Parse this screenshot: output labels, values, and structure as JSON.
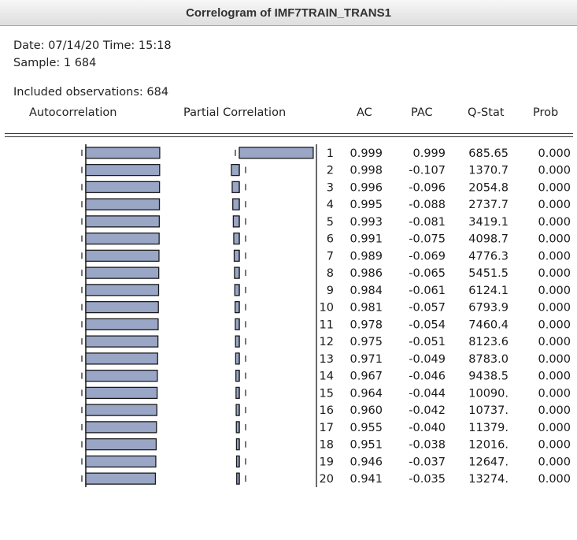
{
  "window": {
    "title": "Correlogram of IMF7TRAIN_TRANS1"
  },
  "meta": {
    "date_line": "Date: 07/14/20   Time: 15:18",
    "sample_line": "Sample: 1 684",
    "obs_line": "Included observations: 684"
  },
  "columns": {
    "autocorrelation": "Autocorrelation",
    "partial_correlation": "Partial Correlation",
    "ac": "AC",
    "pac": "PAC",
    "qstat": "Q-Stat",
    "prob": "Prob"
  },
  "colors": {
    "bar_fill": "#9aa6c6",
    "bar_stroke": "#1a1a1a",
    "text": "#1a1a1a"
  },
  "rows": [
    {
      "lag": "1",
      "ac": "0.999",
      "pac": "0.999",
      "qstat": "685.65",
      "prob": "0.000",
      "ac_value": 0.999,
      "pac_value": 0.999
    },
    {
      "lag": "2",
      "ac": "0.998",
      "pac": "-0.107",
      "qstat": "1370.7",
      "prob": "0.000",
      "ac_value": 0.998,
      "pac_value": -0.107
    },
    {
      "lag": "3",
      "ac": "0.996",
      "pac": "-0.096",
      "qstat": "2054.8",
      "prob": "0.000",
      "ac_value": 0.996,
      "pac_value": -0.096
    },
    {
      "lag": "4",
      "ac": "0.995",
      "pac": "-0.088",
      "qstat": "2737.7",
      "prob": "0.000",
      "ac_value": 0.995,
      "pac_value": -0.088
    },
    {
      "lag": "5",
      "ac": "0.993",
      "pac": "-0.081",
      "qstat": "3419.1",
      "prob": "0.000",
      "ac_value": 0.993,
      "pac_value": -0.081
    },
    {
      "lag": "6",
      "ac": "0.991",
      "pac": "-0.075",
      "qstat": "4098.7",
      "prob": "0.000",
      "ac_value": 0.991,
      "pac_value": -0.075
    },
    {
      "lag": "7",
      "ac": "0.989",
      "pac": "-0.069",
      "qstat": "4776.3",
      "prob": "0.000",
      "ac_value": 0.989,
      "pac_value": -0.069
    },
    {
      "lag": "8",
      "ac": "0.986",
      "pac": "-0.065",
      "qstat": "5451.5",
      "prob": "0.000",
      "ac_value": 0.986,
      "pac_value": -0.065
    },
    {
      "lag": "9",
      "ac": "0.984",
      "pac": "-0.061",
      "qstat": "6124.1",
      "prob": "0.000",
      "ac_value": 0.984,
      "pac_value": -0.061
    },
    {
      "lag": "10",
      "ac": "0.981",
      "pac": "-0.057",
      "qstat": "6793.9",
      "prob": "0.000",
      "ac_value": 0.981,
      "pac_value": -0.057
    },
    {
      "lag": "11",
      "ac": "0.978",
      "pac": "-0.054",
      "qstat": "7460.4",
      "prob": "0.000",
      "ac_value": 0.978,
      "pac_value": -0.054
    },
    {
      "lag": "12",
      "ac": "0.975",
      "pac": "-0.051",
      "qstat": "8123.6",
      "prob": "0.000",
      "ac_value": 0.975,
      "pac_value": -0.051
    },
    {
      "lag": "13",
      "ac": "0.971",
      "pac": "-0.049",
      "qstat": "8783.0",
      "prob": "0.000",
      "ac_value": 0.971,
      "pac_value": -0.049
    },
    {
      "lag": "14",
      "ac": "0.967",
      "pac": "-0.046",
      "qstat": "9438.5",
      "prob": "0.000",
      "ac_value": 0.967,
      "pac_value": -0.046
    },
    {
      "lag": "15",
      "ac": "0.964",
      "pac": "-0.044",
      "qstat": "10090.",
      "prob": "0.000",
      "ac_value": 0.964,
      "pac_value": -0.044
    },
    {
      "lag": "16",
      "ac": "0.960",
      "pac": "-0.042",
      "qstat": "10737.",
      "prob": "0.000",
      "ac_value": 0.96,
      "pac_value": -0.042
    },
    {
      "lag": "17",
      "ac": "0.955",
      "pac": "-0.040",
      "qstat": "11379.",
      "prob": "0.000",
      "ac_value": 0.955,
      "pac_value": -0.04
    },
    {
      "lag": "18",
      "ac": "0.951",
      "pac": "-0.038",
      "qstat": "12016.",
      "prob": "0.000",
      "ac_value": 0.951,
      "pac_value": -0.038
    },
    {
      "lag": "19",
      "ac": "0.946",
      "pac": "-0.037",
      "qstat": "12647.",
      "prob": "0.000",
      "ac_value": 0.946,
      "pac_value": -0.037
    },
    {
      "lag": "20",
      "ac": "0.941",
      "pac": "-0.035",
      "qstat": "13274.",
      "prob": "0.000",
      "ac_value": 0.941,
      "pac_value": -0.035
    }
  ]
}
